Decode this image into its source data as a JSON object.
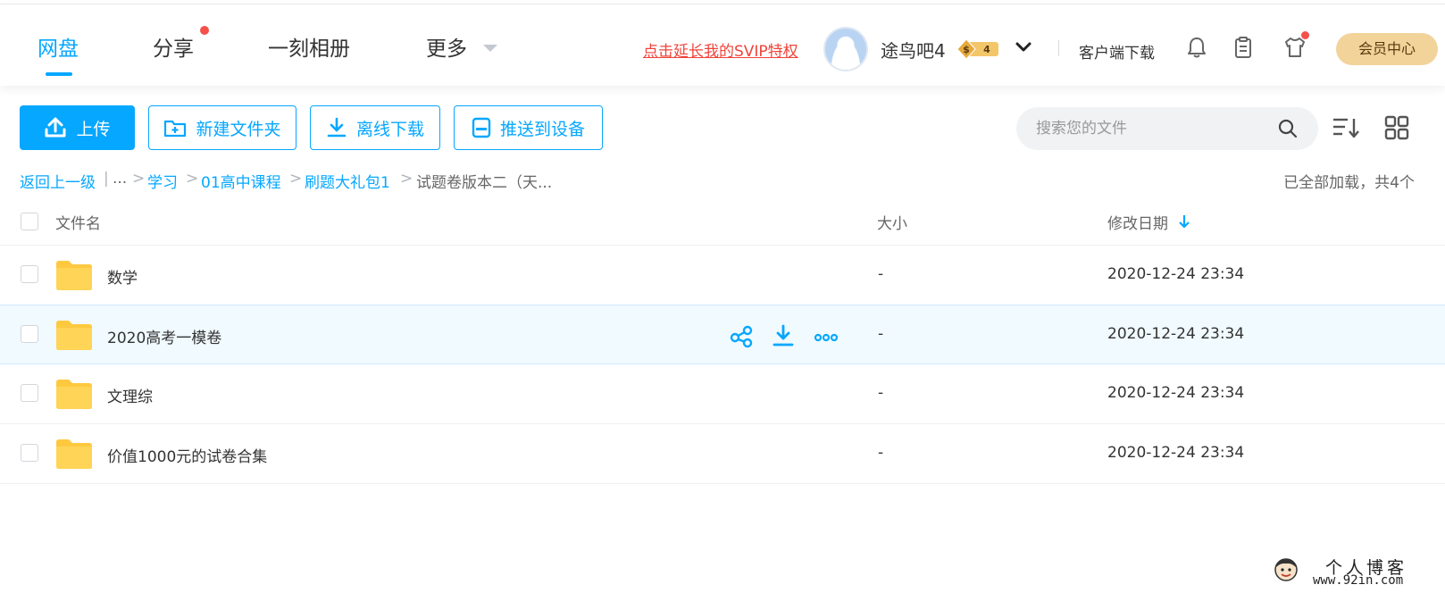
{
  "nav": {
    "tabs": [
      {
        "label": "网盘",
        "active": true
      },
      {
        "label": "分享",
        "badge": true
      },
      {
        "label": "一刻相册"
      },
      {
        "label": "更多",
        "dropdown": true
      }
    ],
    "svip_link": "点击延长我的SVIP特权",
    "username": "途鸟吧4",
    "level": "4",
    "client_download": "客户端下载",
    "vip_center": "会员中心",
    "icons": [
      "bell-icon",
      "clipboard-icon",
      "tshirt-icon"
    ]
  },
  "toolbar": {
    "upload": "上传",
    "new_folder": "新建文件夹",
    "offline_download": "离线下载",
    "push_to_device": "推送到设备",
    "search_placeholder": "搜索您的文件"
  },
  "breadcrumb": {
    "back": "返回上一级",
    "divider": "|",
    "ellipsis": "...",
    "sep": ">",
    "items": [
      "学习",
      "01高中课程",
      "刷题大礼包1"
    ],
    "current": "试题卷版本二（天..."
  },
  "loaded_info": "已全部加载，共4个",
  "table": {
    "headers": {
      "name": "文件名",
      "size": "大小",
      "modified": "修改日期"
    },
    "rows": [
      {
        "name": "数学",
        "size": "-",
        "date": "2020-12-24 23:34"
      },
      {
        "name": "2020高考一模卷",
        "size": "-",
        "date": "2020-12-24 23:34",
        "hovered": true
      },
      {
        "name": "文理综",
        "size": "-",
        "date": "2020-12-24 23:34"
      },
      {
        "name": "价值1000元的试卷合集",
        "size": "-",
        "date": "2020-12-24 23:34"
      }
    ]
  },
  "watermark": {
    "title": "个人博客",
    "url": "www.92in.com"
  },
  "colors": {
    "accent": "#06a7ff",
    "alert": "#f0433a",
    "vip": "#f2d39a",
    "folder": "#ffc93f"
  }
}
